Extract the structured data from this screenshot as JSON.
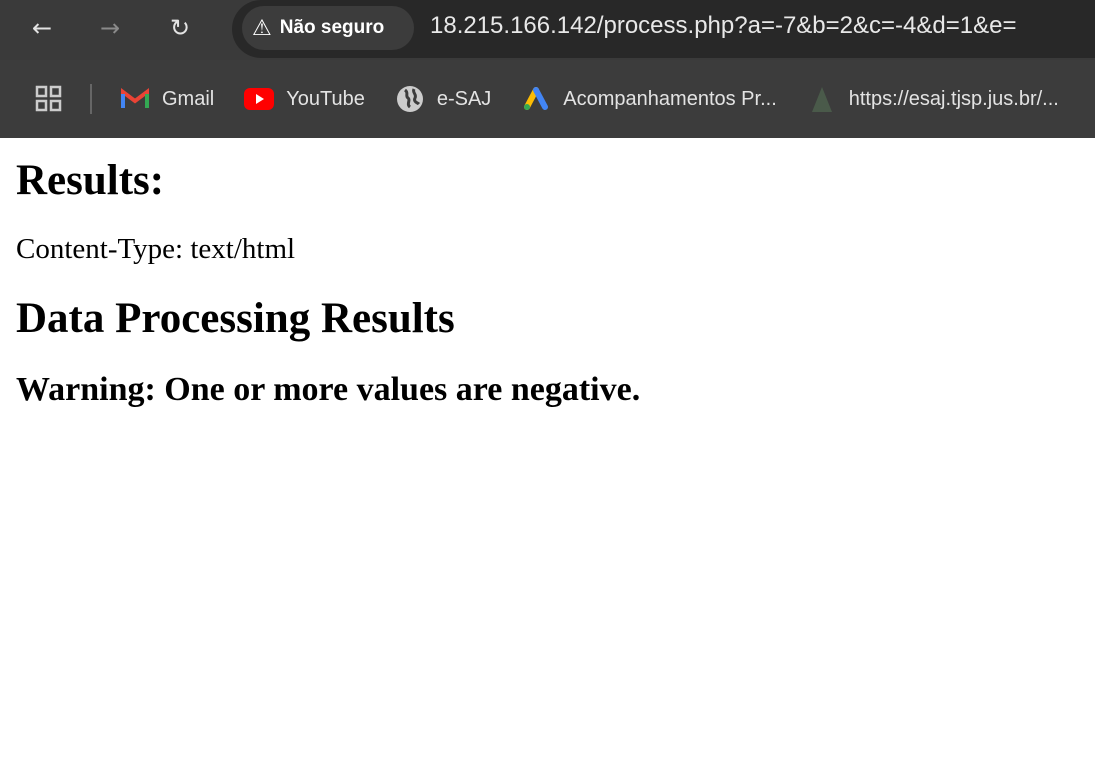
{
  "browser": {
    "security_label": "Não seguro",
    "url": "18.215.166.142/process.php?a=-7&b=2&c=-4&d=1&e=",
    "bookmarks": [
      {
        "label": "Gmail",
        "icon": "gmail-icon"
      },
      {
        "label": "YouTube",
        "icon": "youtube-icon"
      },
      {
        "label": "e-SAJ",
        "icon": "globe-icon"
      },
      {
        "label": "Acompanhamentos Pr...",
        "icon": "google-ads-icon"
      },
      {
        "label": "https://esaj.tjsp.jus.br/...",
        "icon": "esaj-icon"
      }
    ]
  },
  "page": {
    "title": "Results:",
    "content_type": "Content-Type: text/html",
    "heading": "Data Processing Results",
    "warning": "Warning: One or more values are negative."
  }
}
